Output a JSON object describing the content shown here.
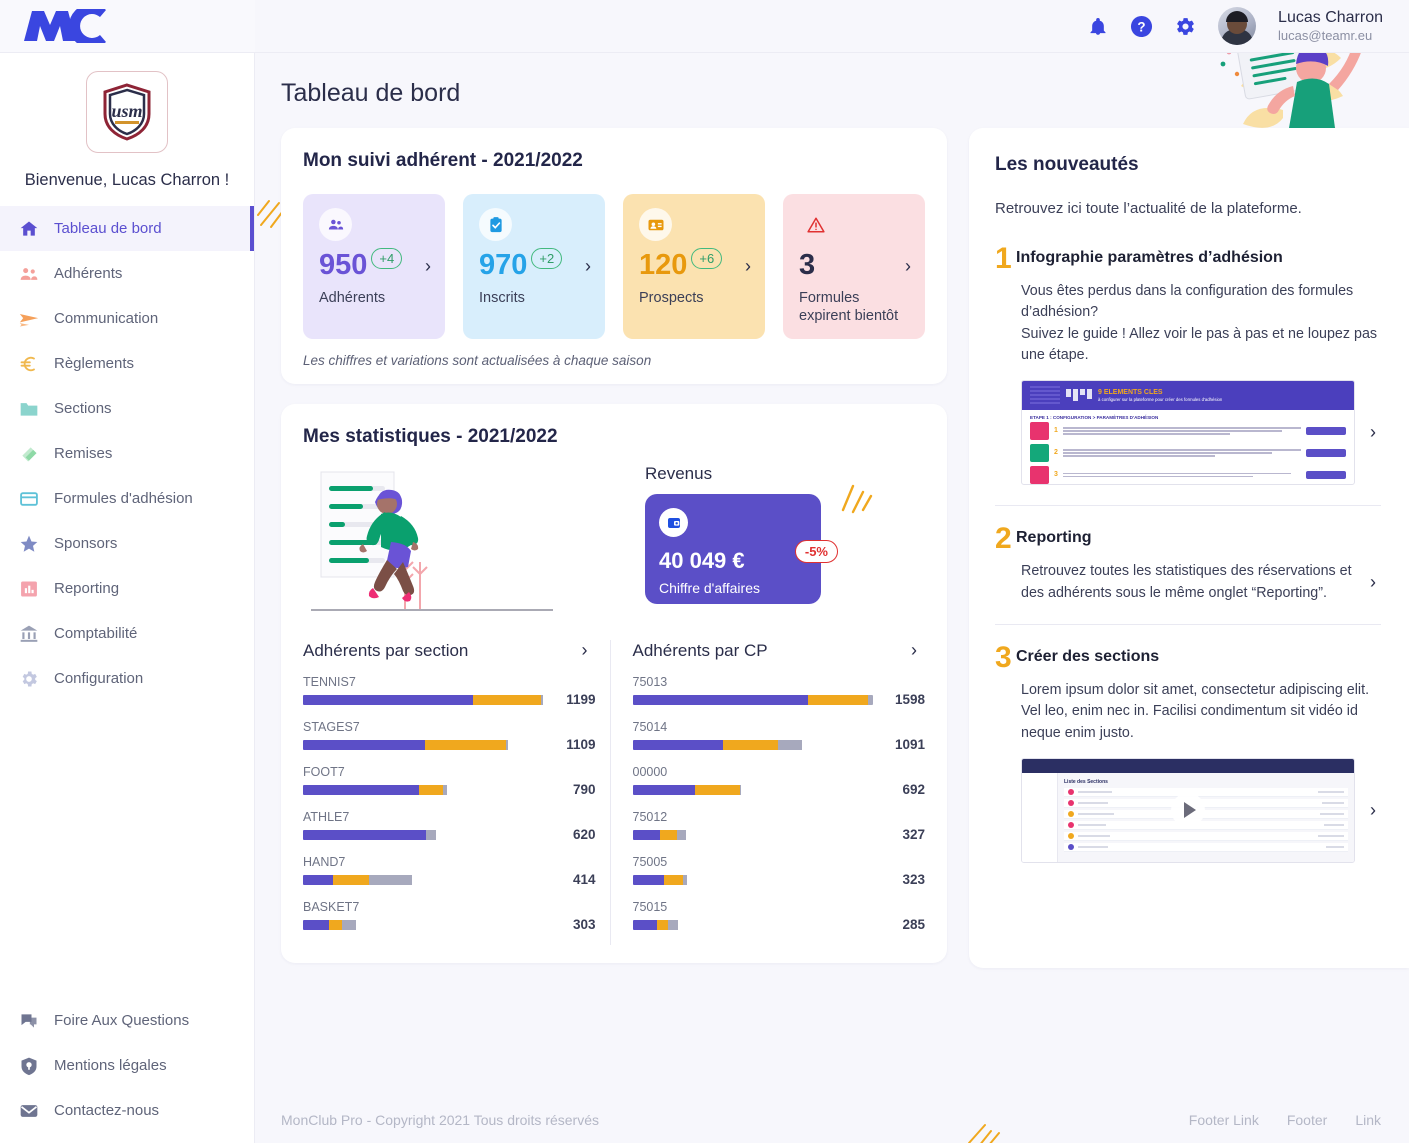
{
  "brand": {
    "logo_text": "MC"
  },
  "topbar": {
    "icons": [
      "bell-icon",
      "help-icon",
      "gear-icon"
    ],
    "user_name": "Lucas Charron",
    "user_email": "lucas@teamr.eu"
  },
  "sidebar": {
    "club_logo_alt": "USM",
    "welcome": "Bienvenue, Lucas Charron !",
    "items": [
      {
        "label": "Tableau de bord",
        "icon": "home-icon",
        "active": true
      },
      {
        "label": "Adhérents",
        "icon": "users-icon",
        "active": false
      },
      {
        "label": "Communication",
        "icon": "send-icon",
        "active": false
      },
      {
        "label": "Règlements",
        "icon": "euro-icon",
        "active": false
      },
      {
        "label": "Sections",
        "icon": "folder-icon",
        "active": false
      },
      {
        "label": "Remises",
        "icon": "tag-icon",
        "active": false
      },
      {
        "label": "Formules d'adhésion",
        "icon": "card-icon",
        "active": false
      },
      {
        "label": "Sponsors",
        "icon": "star-icon",
        "active": false
      },
      {
        "label": "Reporting",
        "icon": "chart-icon",
        "active": false
      },
      {
        "label": "Comptabilité",
        "icon": "bank-icon",
        "active": false
      },
      {
        "label": "Configuration",
        "icon": "cog-icon",
        "active": false
      }
    ],
    "bottom_items": [
      {
        "label": "Foire Aux Questions",
        "icon": "chat-icon"
      },
      {
        "label": "Mentions légales",
        "icon": "shield-icon"
      },
      {
        "label": "Contactez-nous",
        "icon": "mail-icon"
      }
    ]
  },
  "page": {
    "title": "Tableau de bord"
  },
  "suivi": {
    "title": "Mon suivi adhérent - 2021/2022",
    "note": "Les chiffres et variations sont actualisées à chaque saison",
    "cards": [
      {
        "value": "950",
        "delta": "+4",
        "label": "Adhérents",
        "icon": "users-icon",
        "bg": "#e9e4fb",
        "num_color": "#6a53d6",
        "icon_color": "#6a53d6"
      },
      {
        "value": "970",
        "delta": "+2",
        "label": "Inscrits",
        "icon": "clipboard-check-icon",
        "bg": "#d8eefc",
        "num_color": "#26a3e8",
        "icon_color": "#1f9ae2"
      },
      {
        "value": "120",
        "delta": "+6",
        "label": "Prospects",
        "icon": "id-card-icon",
        "bg": "#fbe2b0",
        "num_color": "#e8990d",
        "icon_color": "#e8990d"
      },
      {
        "value": "3",
        "delta": "",
        "label": "Formules\nexpirent bientôt",
        "icon": "warning-icon",
        "bg": "#fbdfe2",
        "num_color": "#2b2e4a",
        "icon_color": "#e03131"
      }
    ]
  },
  "stats": {
    "title": "Mes statistiques - 2021/2022",
    "revenus_label": "Revenus",
    "revenue": {
      "amount": "40 049 €",
      "caption": "Chiffre d'affaires",
      "delta": "-5%",
      "bg": "#5b4fc7",
      "delta_color": "#e03131"
    }
  },
  "chart_data": [
    {
      "type": "bar",
      "title": "Adhérents par section",
      "orientation": "horizontal",
      "stacked": true,
      "xlabel": "",
      "ylabel": "",
      "series_colors": {
        "principal": "#5b4fc7",
        "secondaire": "#f0a81e",
        "tertiaire": "#a7a9bd"
      },
      "categories": [
        "TENNIS7",
        "STAGES7",
        "FOOT7",
        "ATHLE7",
        "HAND7",
        "BASKET7"
      ],
      "values": [
        1199,
        1109,
        790,
        620,
        414,
        303
      ],
      "segments": [
        {
          "category": "TENNIS7",
          "total": 1199,
          "parts": [
            735,
            290,
            12
          ]
        },
        {
          "category": "STAGES7",
          "total": 1109,
          "parts": [
            525,
            350,
            10
          ]
        },
        {
          "category": "FOOT7",
          "total": 790,
          "parts": [
            500,
            105,
            15
          ]
        },
        {
          "category": "ATHLE7",
          "total": 620,
          "parts": [
            530,
            0,
            45
          ]
        },
        {
          "category": "HAND7",
          "total": 414,
          "parts": [
            130,
            155,
            185
          ]
        },
        {
          "category": "BASKET7",
          "total": 303,
          "parts": [
            110,
            60,
            60
          ]
        }
      ]
    },
    {
      "type": "bar",
      "title": "Adhérents par CP",
      "orientation": "horizontal",
      "stacked": true,
      "xlabel": "",
      "ylabel": "",
      "series_colors": {
        "principal": "#5b4fc7",
        "secondaire": "#f0a81e",
        "tertiaire": "#a7a9bd"
      },
      "categories": [
        "75013",
        "75014",
        "00000",
        "75012",
        "75005",
        "75015"
      ],
      "values": [
        1598,
        1091,
        692,
        327,
        323,
        285
      ],
      "segments": [
        {
          "category": "75013",
          "total": 1598,
          "parts": [
            745,
            255,
            22
          ]
        },
        {
          "category": "75014",
          "total": 1091,
          "parts": [
            385,
            235,
            100
          ]
        },
        {
          "category": "00000",
          "total": 692,
          "parts": [
            265,
            190,
            8
          ]
        },
        {
          "category": "75012",
          "total": 327,
          "parts": [
            118,
            73,
            36
          ]
        },
        {
          "category": "75005",
          "total": 323,
          "parts": [
            135,
            80,
            15
          ]
        },
        {
          "category": "75015",
          "total": 285,
          "parts": [
            105,
            45,
            45
          ]
        }
      ]
    }
  ],
  "news": {
    "title": "Les nouveautés",
    "intro": "Retrouvez ici toute l’actualité de la plateforme.",
    "items": [
      {
        "num": "1",
        "title": "Infographie paramètres d’adhésion",
        "text": "Vous êtes perdus dans la configuration des formules d’adhésion?\nSuivez le guide ! Allez voir le pas à pas et ne loupez pas une étape.",
        "thumb": "infographic",
        "thumb_heading": "9 ELEMENTS CLES",
        "thumb_sub": "à configurer sur la plateforme pour créer des formules d'adhésion",
        "thumb_section": "ETAPE 1 : CONFIGURATION > PARAMÈTRES D'ADHÉSION",
        "thumb_rows": [
          "Questions",
          "Documents",
          "Gestion analytique"
        ]
      },
      {
        "num": "2",
        "title": "Reporting",
        "text": "Retrouvez toutes les statistiques des réservations et des adhérents sous le même onglet “Reporting”.",
        "thumb": ""
      },
      {
        "num": "3",
        "title": "Créer des sections",
        "text": "Lorem ipsum dolor sit amet, consectetur adipiscing elit. Vel leo, enim nec in. Facilisi condimentum sit vidéo id neque enim justo.",
        "thumb": "video",
        "thumb_heading": "Liste des Sections"
      }
    ]
  },
  "footer": {
    "copyright": "MonClub Pro - Copyright 2021 Tous droits réservés",
    "links": [
      "Footer Link",
      "Footer",
      "Link"
    ]
  }
}
